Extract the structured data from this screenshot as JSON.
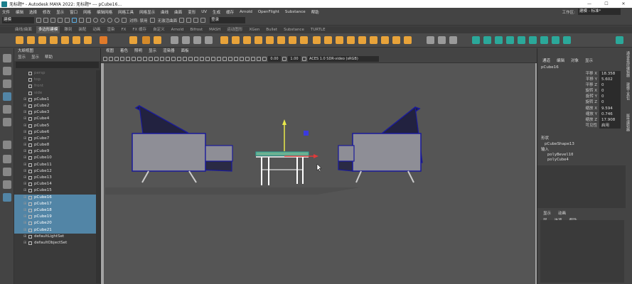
{
  "window": {
    "title": "无标题* - Autodesk MAYA 2022: 无标题*   ---   pCube16...",
    "minimize": "—",
    "maximize": "☐",
    "close": "✕"
  },
  "menubar": {
    "items": [
      "文件",
      "编辑",
      "选择",
      "修改",
      "显示",
      "窗口",
      "网格",
      "编辑网格",
      "网格工具",
      "网格显示",
      "曲线",
      "曲面",
      "变形",
      "UV",
      "生成",
      "缓存",
      "Arnold",
      "OpenFlight",
      "Substance",
      "帮助"
    ],
    "workspace_label": "工作区:",
    "workspace_value": "建模 - 标准*"
  },
  "statusline": {
    "mode": "建模",
    "symmetry": "对称: 禁用",
    "live": "无激活曲面",
    "login": "登录"
  },
  "shelf_tabs": [
    "曲线/曲面",
    "多边形建模",
    "雕刻",
    "装配",
    "动画",
    "渲染",
    "FX",
    "FX 缓存",
    "自定义",
    "Arnold",
    "Bifrost",
    "MASH",
    "运动图形",
    "XGen",
    "Bullet",
    "Substance",
    "TURTLE"
  ],
  "shelf_active_index": 1,
  "outliner": {
    "title": "大纲视图",
    "menu": [
      "显示",
      "显示",
      "帮助"
    ],
    "rows": [
      {
        "label": "persp",
        "dim": true,
        "selected": false
      },
      {
        "label": "top",
        "dim": true,
        "selected": false
      },
      {
        "label": "front",
        "dim": true,
        "selected": false
      },
      {
        "label": "side",
        "dim": true,
        "selected": false
      },
      {
        "label": "pCube1",
        "dim": false,
        "selected": false
      },
      {
        "label": "pCube2",
        "dim": false,
        "selected": false
      },
      {
        "label": "pCube3",
        "dim": false,
        "selected": false
      },
      {
        "label": "pCube4",
        "dim": false,
        "selected": false
      },
      {
        "label": "pCube5",
        "dim": false,
        "selected": false
      },
      {
        "label": "pCube6",
        "dim": false,
        "selected": false
      },
      {
        "label": "pCube7",
        "dim": false,
        "selected": false
      },
      {
        "label": "pCube8",
        "dim": false,
        "selected": false
      },
      {
        "label": "pCube9",
        "dim": false,
        "selected": false
      },
      {
        "label": "pCube10",
        "dim": false,
        "selected": false
      },
      {
        "label": "pCube11",
        "dim": false,
        "selected": false
      },
      {
        "label": "pCube12",
        "dim": false,
        "selected": false
      },
      {
        "label": "pCube13",
        "dim": false,
        "selected": false
      },
      {
        "label": "pCube14",
        "dim": false,
        "selected": false
      },
      {
        "label": "pCube15",
        "dim": false,
        "selected": false
      },
      {
        "label": "pCube16",
        "dim": false,
        "selected": true
      },
      {
        "label": "pCube17",
        "dim": false,
        "selected": true
      },
      {
        "label": "pCube18",
        "dim": false,
        "selected": true
      },
      {
        "label": "pCube19",
        "dim": false,
        "selected": true
      },
      {
        "label": "pCube20",
        "dim": false,
        "selected": true
      },
      {
        "label": "pCube21",
        "dim": false,
        "selected": true
      },
      {
        "label": "defaultLightSet",
        "dim": false,
        "selected": false
      },
      {
        "label": "defaultObjectSet",
        "dim": false,
        "selected": false
      }
    ]
  },
  "viewport": {
    "menu": [
      "视图",
      "着色",
      "照明",
      "显示",
      "渲染器",
      "面板"
    ],
    "num1": "0.00",
    "num2": "1.00",
    "colorspace": "ACES 1.0 SDR-video (sRGB)"
  },
  "channelbox": {
    "tabs": [
      "通道",
      "编辑",
      "对象",
      "显示"
    ],
    "object": "pCube16",
    "attributes": [
      {
        "name": "平移 X",
        "value": "18.358"
      },
      {
        "name": "平移 Y",
        "value": "5.602"
      },
      {
        "name": "平移 Z",
        "value": "0"
      },
      {
        "name": "旋转 X",
        "value": "0"
      },
      {
        "name": "旋转 Y",
        "value": "0"
      },
      {
        "name": "旋转 Z",
        "value": "0"
      },
      {
        "name": "缩放 X",
        "value": "9.594"
      },
      {
        "name": "缩放 Y",
        "value": "0.746"
      },
      {
        "name": "缩放 Z",
        "value": "17.908"
      },
      {
        "name": "可见性",
        "value": "启用"
      }
    ],
    "shapes_label": "形状",
    "shape": "pCubeShape13",
    "inputs_label": "输入",
    "inputs": [
      "polyBevel10",
      "polyCube4"
    ]
  },
  "layers": {
    "tabs": [
      "显示",
      "动画"
    ],
    "menu": [
      "层",
      "选项",
      "帮助"
    ]
  },
  "side_tabs": [
    "通道盒/层编辑器",
    "建模工具包",
    "属性编辑器"
  ]
}
